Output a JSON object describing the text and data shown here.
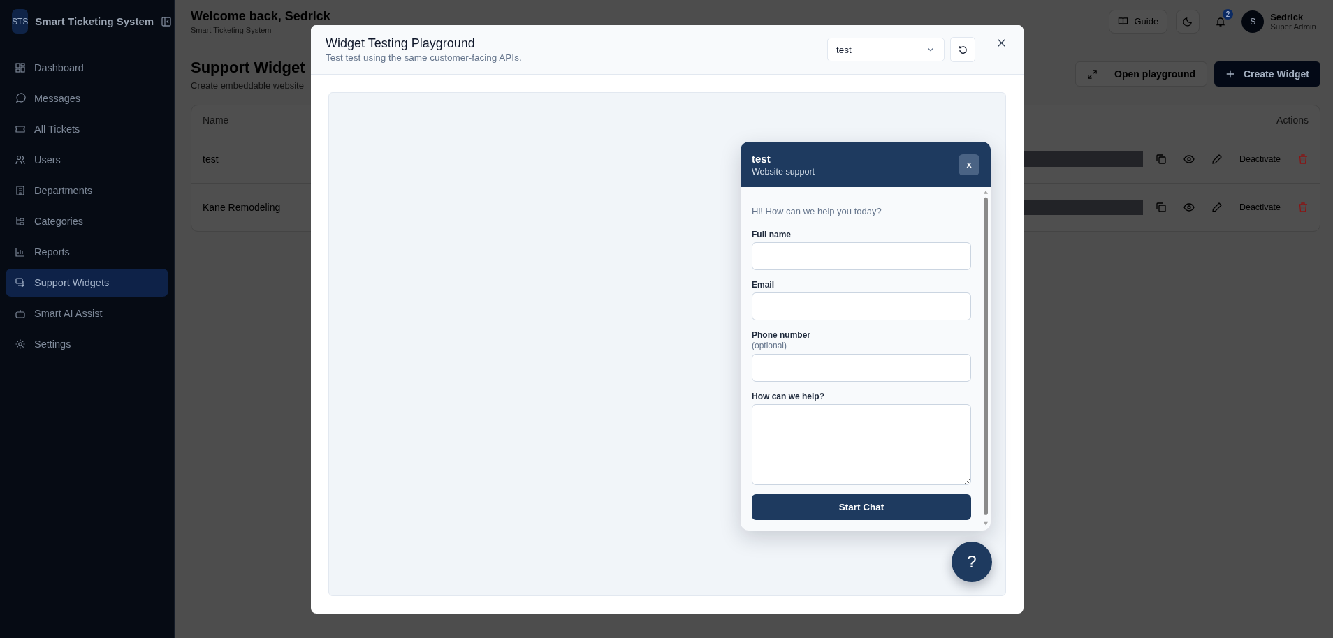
{
  "sidebar": {
    "logo": "STS",
    "title": "Smart Ticketing System",
    "items": [
      {
        "label": "Dashboard",
        "selected": false
      },
      {
        "label": "Messages",
        "selected": false
      },
      {
        "label": "All Tickets",
        "selected": false
      },
      {
        "label": "Users",
        "selected": false
      },
      {
        "label": "Departments",
        "selected": false
      },
      {
        "label": "Categories",
        "selected": false
      },
      {
        "label": "Reports",
        "selected": false
      },
      {
        "label": "Support Widgets",
        "selected": true
      },
      {
        "label": "Smart AI Assist",
        "selected": false
      },
      {
        "label": "Settings",
        "selected": false
      }
    ]
  },
  "header": {
    "title": "Welcome back, Sedrick",
    "subtitle": "Smart Ticketing System",
    "guide": "Guide",
    "notification_count": "2",
    "user": {
      "initial": "S",
      "name": "Sedrick",
      "role": "Super Admin"
    }
  },
  "page": {
    "title": "Support Widget",
    "subtitle": "Create embeddable website",
    "open_button": "Open playground",
    "create_button": "Create Widget",
    "table": {
      "columns": [
        "Name",
        "Actions"
      ],
      "rows": [
        {
          "name": "test",
          "action": "Deactivate"
        },
        {
          "name": "Kane Remodeling",
          "action": "Deactivate"
        }
      ]
    }
  },
  "modal": {
    "title": "Widget Testing Playground",
    "subtitle": "Test test using the same customer-facing APIs.",
    "select_value": "test",
    "widget": {
      "title": "test",
      "subtitle": "Website support",
      "close": "x",
      "greeting": "Hi! How can we help you today?",
      "fields": [
        {
          "label": "Full name",
          "kind": "input"
        },
        {
          "label": "Email",
          "kind": "input"
        },
        {
          "label": "Phone number",
          "note": "(optional)",
          "kind": "input"
        },
        {
          "label": "How can we help?",
          "kind": "textarea"
        }
      ],
      "submit": "Start Chat",
      "fab": "?"
    }
  }
}
